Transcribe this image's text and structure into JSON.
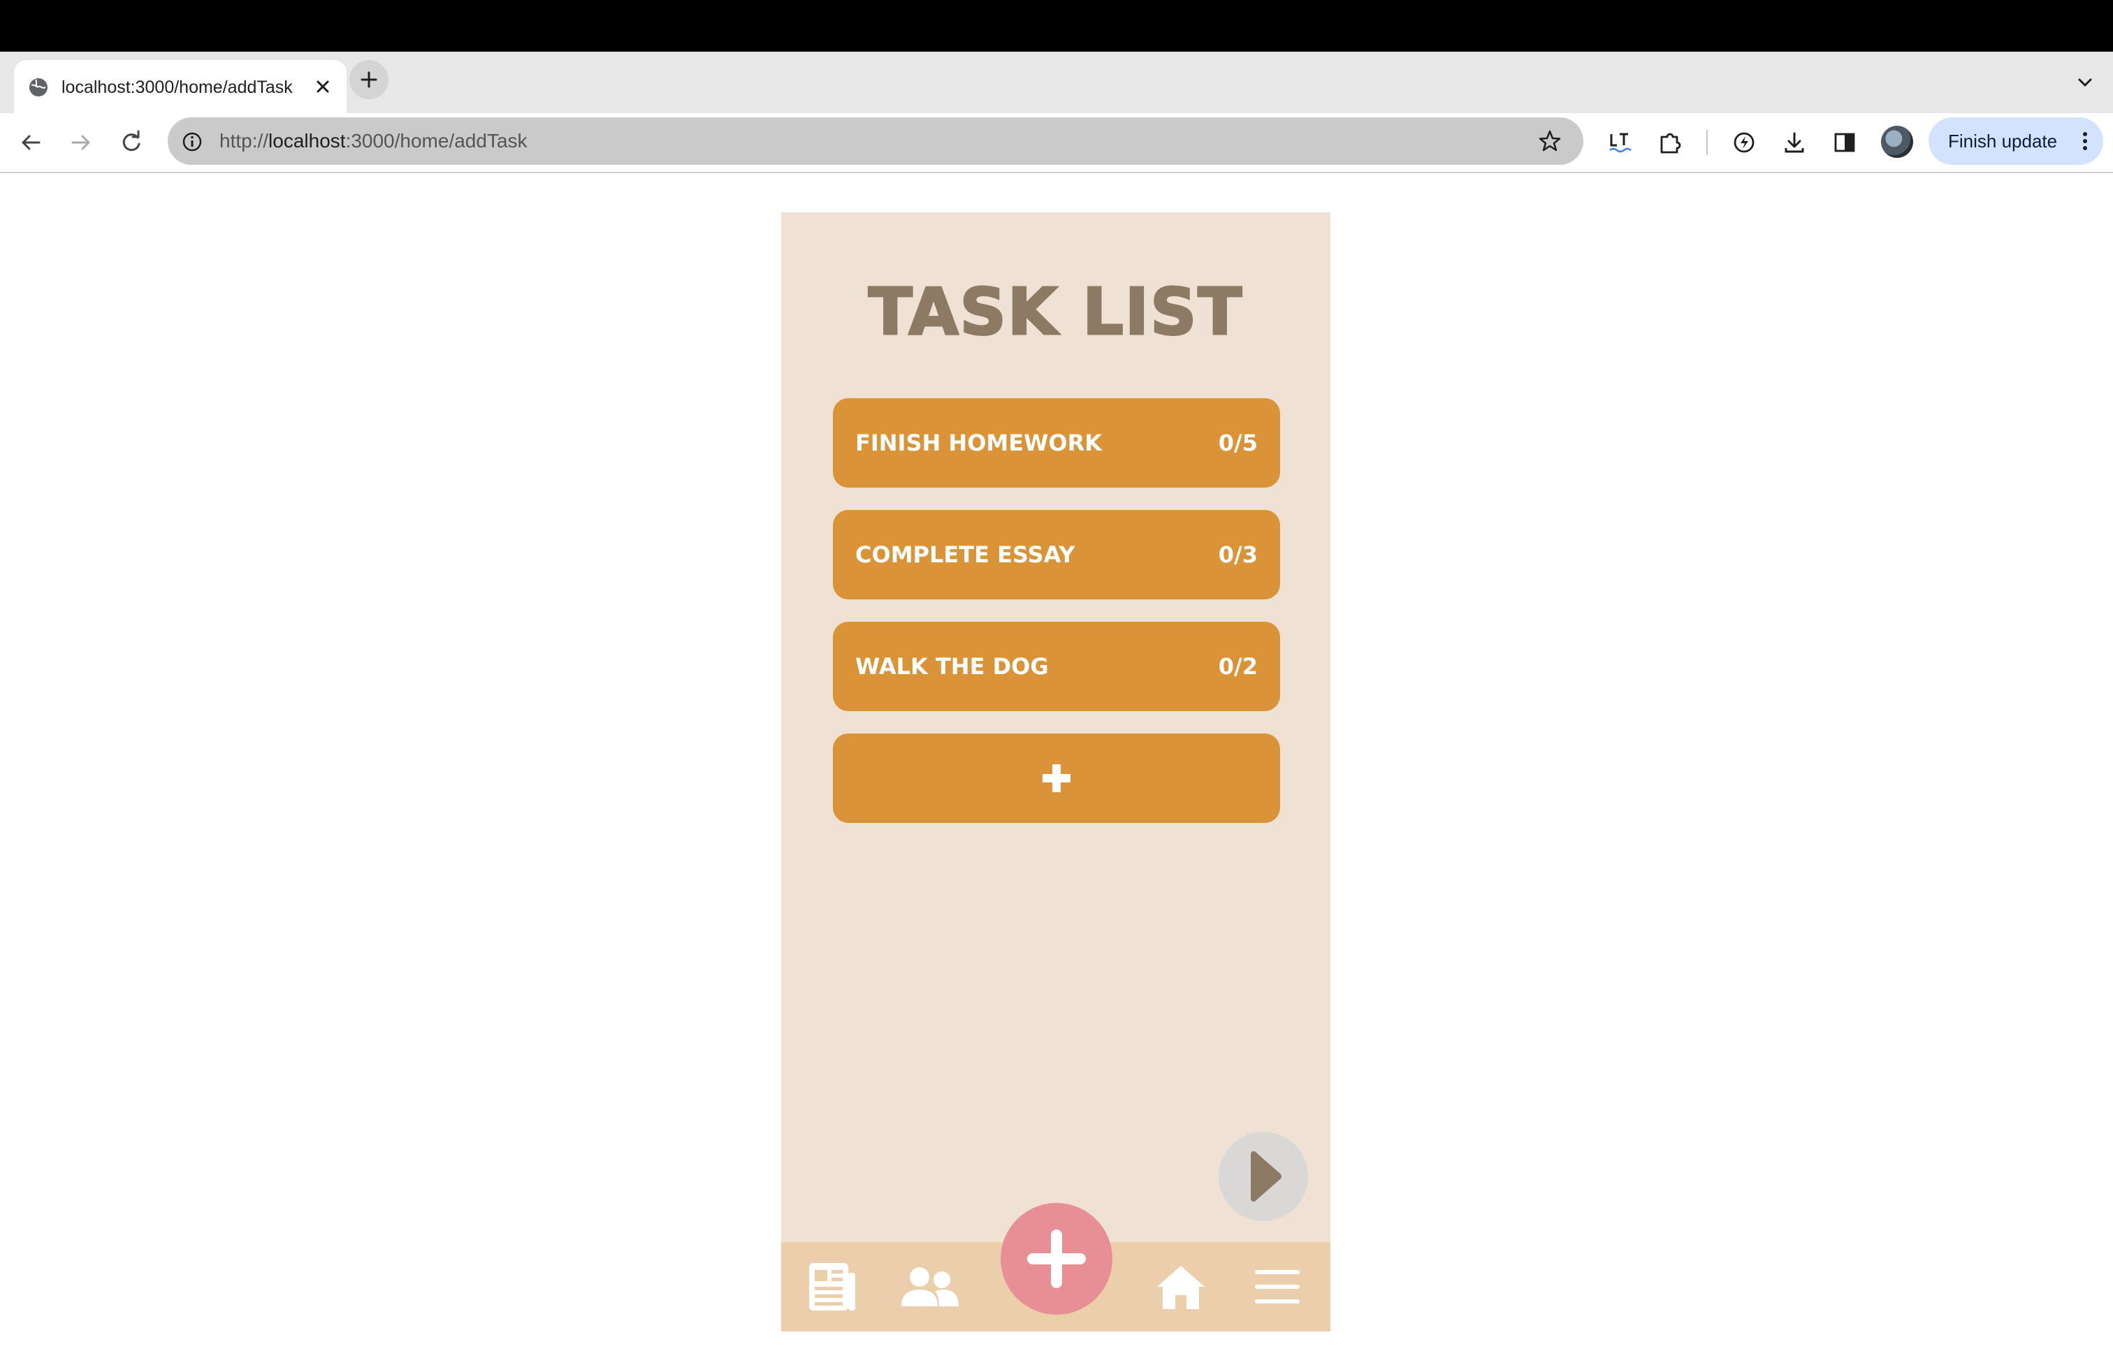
{
  "browser": {
    "tab": {
      "title": "localhost:3000/home/addTask"
    },
    "address": {
      "scheme": "http://",
      "host": "localhost",
      "rest": ":3000/home/addTask"
    },
    "finish_update_label": "Finish update"
  },
  "app": {
    "title": "Task List",
    "tasks": [
      {
        "name": "Finish homework",
        "progress": "0/5"
      },
      {
        "name": "Complete essay",
        "progress": "0/3"
      },
      {
        "name": "Walk the dog",
        "progress": "0/2"
      }
    ],
    "add_task_icon": "plus-icon",
    "next_icon": "play-icon",
    "bottom_nav": [
      {
        "icon": "newspaper-icon"
      },
      {
        "icon": "users-icon"
      },
      {
        "icon": "plus-icon",
        "primary": true
      },
      {
        "icon": "home-icon"
      },
      {
        "icon": "menu-icon"
      }
    ],
    "colors": {
      "background": "#efe2d4",
      "title": "#8c7a65",
      "task": "#da9337",
      "nav": "#ebcfab",
      "fab": "#e78f94",
      "next_button": "#dad8d6"
    }
  }
}
